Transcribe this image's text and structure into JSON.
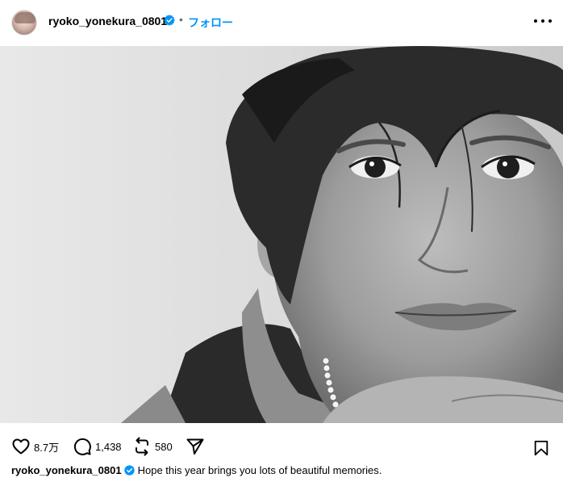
{
  "header": {
    "username": "ryoko_yonekura_0801",
    "separator": "•",
    "follow_label": "フォロー"
  },
  "post": {
    "image_alt": "black and white portrait photo"
  },
  "actions": {
    "likes": "8.7万",
    "comments": "1,438",
    "reposts": "580"
  },
  "caption": {
    "username": "ryoko_yonekura_0801",
    "text": "Hope this year brings you lots of beautiful memories."
  },
  "colors": {
    "accent": "#0095f6",
    "verified": "#0095f6"
  }
}
